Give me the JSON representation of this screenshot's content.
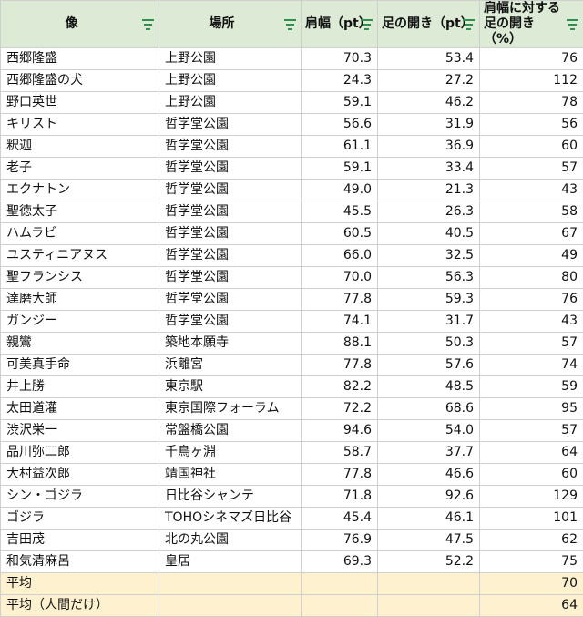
{
  "headers": [
    {
      "label": "像",
      "icon": "filter-icon"
    },
    {
      "label": "場所",
      "icon": "filter-icon"
    },
    {
      "label": "肩幅（pt）",
      "icon": "filter-icon"
    },
    {
      "label": "足の開き（pt）",
      "icon": "filter-icon"
    },
    {
      "label": "肩幅に対する足の開き（%）",
      "icon": "filter-icon"
    }
  ],
  "rows": [
    [
      "西郷隆盛",
      "上野公園",
      "70.3",
      "53.4",
      "76"
    ],
    [
      "西郷隆盛の犬",
      "上野公園",
      "24.3",
      "27.2",
      "112"
    ],
    [
      "野口英世",
      "上野公園",
      "59.1",
      "46.2",
      "78"
    ],
    [
      "キリスト",
      "哲学堂公園",
      "56.6",
      "31.9",
      "56"
    ],
    [
      "釈迦",
      "哲学堂公園",
      "61.1",
      "36.9",
      "60"
    ],
    [
      "老子",
      "哲学堂公園",
      "59.1",
      "33.4",
      "57"
    ],
    [
      "エクナトン",
      "哲学堂公園",
      "49.0",
      "21.3",
      "43"
    ],
    [
      "聖徳太子",
      "哲学堂公園",
      "45.5",
      "26.3",
      "58"
    ],
    [
      "ハムラビ",
      "哲学堂公園",
      "60.5",
      "40.5",
      "67"
    ],
    [
      "ユスティニアヌス",
      "哲学堂公園",
      "66.0",
      "32.5",
      "49"
    ],
    [
      "聖フランシス",
      "哲学堂公園",
      "70.0",
      "56.3",
      "80"
    ],
    [
      "達磨大師",
      "哲学堂公園",
      "77.8",
      "59.3",
      "76"
    ],
    [
      "ガンジー",
      "哲学堂公園",
      "74.1",
      "31.7",
      "43"
    ],
    [
      "親鸞",
      "築地本願寺",
      "88.1",
      "50.3",
      "57"
    ],
    [
      "可美真手命",
      "浜離宮",
      "77.8",
      "57.6",
      "74"
    ],
    [
      "井上勝",
      "東京駅",
      "82.2",
      "48.5",
      "59"
    ],
    [
      "太田道灌",
      "東京国際フォーラム",
      "72.2",
      "68.6",
      "95"
    ],
    [
      "渋沢栄一",
      "常盤橋公園",
      "94.6",
      "54.0",
      "57"
    ],
    [
      "品川弥二郎",
      "千鳥ヶ淵",
      "58.7",
      "37.7",
      "64"
    ],
    [
      "大村益次郎",
      "靖国神社",
      "77.8",
      "46.6",
      "60"
    ],
    [
      "シン・ゴジラ",
      "日比谷シャンテ",
      "71.8",
      "92.6",
      "129"
    ],
    [
      "ゴジラ",
      "TOHOシネマズ日比谷",
      "45.4",
      "46.1",
      "101"
    ],
    [
      "吉田茂",
      "北の丸公園",
      "76.9",
      "47.5",
      "62"
    ],
    [
      "和気清麻呂",
      "皇居",
      "69.3",
      "52.2",
      "75"
    ]
  ],
  "averages": [
    {
      "label": "平均",
      "value": "70"
    },
    {
      "label": "平均（人間だけ）",
      "value": "64"
    }
  ]
}
